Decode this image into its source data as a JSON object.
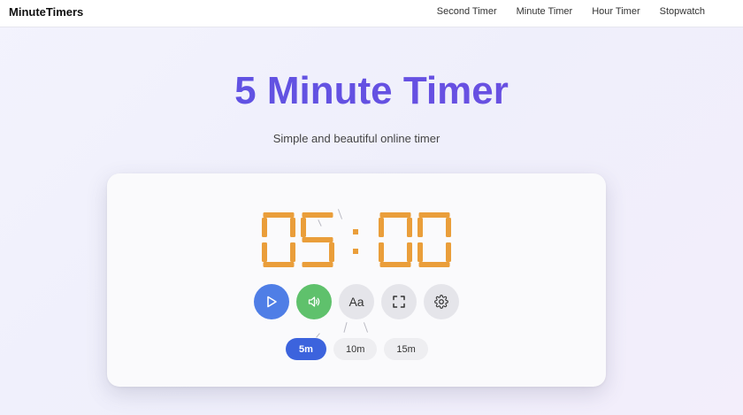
{
  "header": {
    "brand": "MinuteTimers",
    "nav": [
      "Second Timer",
      "Minute Timer",
      "Hour Timer",
      "Stopwatch"
    ]
  },
  "hero": {
    "title": "5 Minute Timer",
    "subtitle": "Simple and beautiful online timer"
  },
  "timer": {
    "display": "05:00",
    "digit_color": "#ea9e3a"
  },
  "controls": {
    "play_icon": "play-icon",
    "sound_icon": "speaker-icon",
    "font_label": "Aa",
    "fullscreen_icon": "fullscreen-icon",
    "settings_icon": "gear-icon"
  },
  "presets": [
    {
      "label": "5m",
      "active": true
    },
    {
      "label": "10m",
      "active": false
    },
    {
      "label": "15m",
      "active": false
    }
  ],
  "colors": {
    "play": "#4f7ee6",
    "sound": "#5fc16c",
    "preset_active": "#3c63dd",
    "title_gradient_start": "#5a55e4",
    "title_gradient_end": "#6f4de0"
  }
}
